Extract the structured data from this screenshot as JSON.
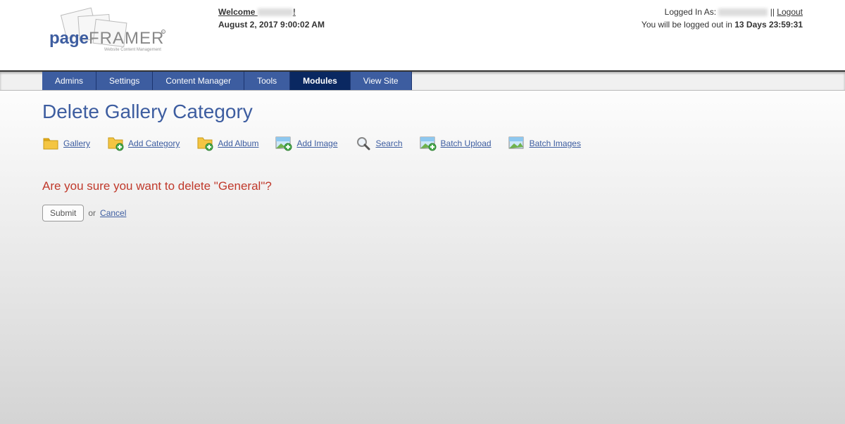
{
  "header": {
    "welcome_prefix": "Welcome ",
    "welcome_suffix": "!",
    "date": "August 2, 2017 9:00:02 AM",
    "logged_in_label": "Logged In As: ",
    "sep": " || ",
    "logout": "Logout",
    "expire_prefix": "You will be logged out in ",
    "expire_value": "13 Days 23:59:31",
    "brand_page": "page",
    "brand_framer": "FRAMER",
    "brand_tag": "Website Content Management"
  },
  "nav": {
    "items": [
      {
        "label": "Admins"
      },
      {
        "label": "Settings"
      },
      {
        "label": "Content Manager"
      },
      {
        "label": "Tools"
      },
      {
        "label": "Modules",
        "active": true
      },
      {
        "label": "View Site"
      }
    ]
  },
  "page": {
    "title": "Delete Gallery Category"
  },
  "toolbar": {
    "gallery": "Gallery",
    "add_category": "Add Category",
    "add_album": "Add Album",
    "add_image": "Add Image",
    "search": "Search",
    "batch_upload": "Batch Upload",
    "batch_images": "Batch Images"
  },
  "confirm": {
    "message": "Are you sure you want to delete \"General\"?",
    "submit": "Submit",
    "or": " or ",
    "cancel": "Cancel"
  }
}
